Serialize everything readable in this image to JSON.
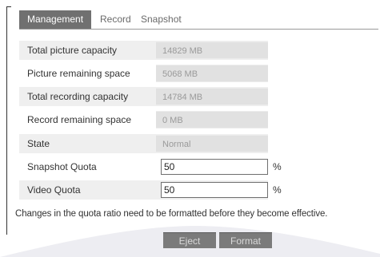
{
  "tabs": [
    {
      "label": "Management",
      "active": true
    },
    {
      "label": "Record",
      "active": false
    },
    {
      "label": "Snapshot",
      "active": false
    }
  ],
  "fields": {
    "total_picture_capacity": {
      "label": "Total picture capacity",
      "value": "14829 MB"
    },
    "picture_remaining_space": {
      "label": "Picture remaining space",
      "value": "5068 MB"
    },
    "total_recording_capacity": {
      "label": "Total recording capacity",
      "value": "14784 MB"
    },
    "record_remaining_space": {
      "label": "Record remaining space",
      "value": "0 MB"
    },
    "state": {
      "label": "State",
      "value": "Normal"
    },
    "snapshot_quota": {
      "label": "Snapshot Quota",
      "value": "50",
      "unit": "%"
    },
    "video_quota": {
      "label": "Video Quota",
      "value": "50",
      "unit": "%"
    }
  },
  "note": "Changes in the quota ratio need to be formatted before they become effective.",
  "buttons": {
    "eject": "Eject",
    "format": "Format"
  },
  "colors": {
    "active_tab": "#707070",
    "button": "#7b7b7b",
    "readonly_bg": "#e1e1e1",
    "row_bg": "#efefef"
  }
}
